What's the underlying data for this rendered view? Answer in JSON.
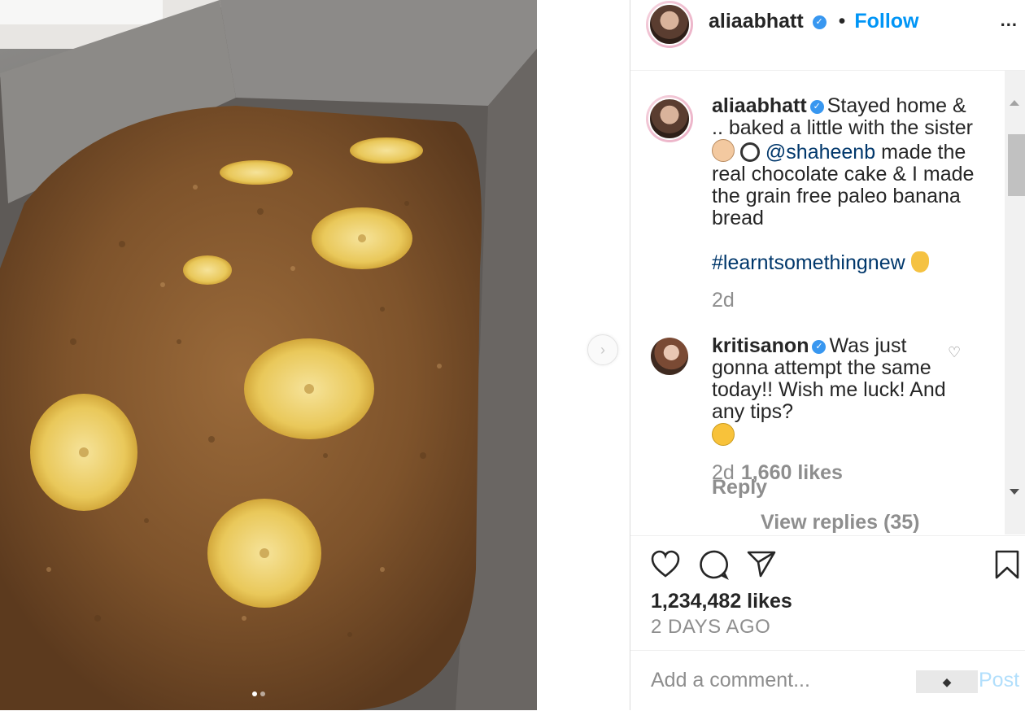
{
  "post": {
    "author": {
      "username": "aliaabhatt",
      "verified_icon": "verified-badge-icon",
      "follow_label": "Follow",
      "separator": "•",
      "more_label": "..."
    },
    "caption": {
      "username": "aliaabhatt",
      "text_part1": "Stayed home & .. baked a little with the sister",
      "emoji1": "baby-face-emoji",
      "emoji2": "frying-pan-emoji",
      "mention": "@shaheenb",
      "text_part2": "made the real chocolate cake & I made the grain free paleo banana bread",
      "hashtag": "#learntsomethingnew",
      "emoji3": "vulcan-salute-emoji",
      "time": "2d"
    },
    "comment": {
      "username": "kritisanon",
      "text": "Was just gonna attempt the same today!! Wish me luck! And any tips?",
      "emoji": "tongue-wink-emoji",
      "time": "2d",
      "likes": "1,660 likes",
      "reply_label": "Reply",
      "view_replies": "View replies (35)"
    },
    "likes": "1,234,482 likes",
    "date": "2 DAYS AGO",
    "add_comment_placeholder": "Add a comment...",
    "post_label": "Post"
  },
  "colors": {
    "link_blue": "#0095f6",
    "mention_blue": "#00376b",
    "muted_gray": "#8e8e8e",
    "post_disabled": "#b2dffc"
  }
}
